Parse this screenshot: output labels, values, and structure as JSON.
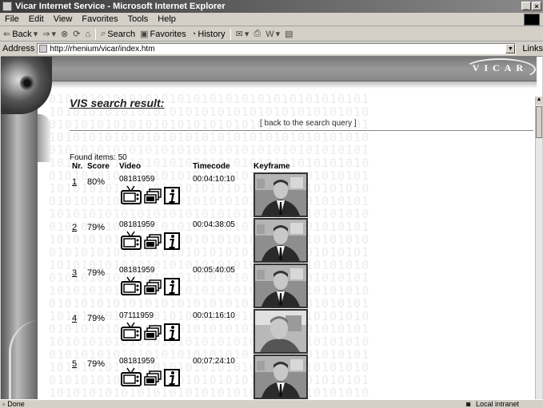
{
  "window": {
    "title": "Vicar Internet Service - Microsoft Internet Explorer",
    "controls": [
      "_",
      "×"
    ]
  },
  "menu": [
    "File",
    "Edit",
    "View",
    "Favorites",
    "Tools",
    "Help"
  ],
  "toolbar": {
    "back": "Back",
    "search": "Search",
    "favorites": "Favorites",
    "history": "History"
  },
  "address": {
    "label": "Address",
    "url": "http://rhenium/vicar/index.htm",
    "links": "Links"
  },
  "page": {
    "brand": "VICAR",
    "heading": "VIS search result:",
    "back_link": "[ back to the search query ]",
    "found": "Found items: 50",
    "columns": {
      "nr": "Nr.",
      "score": "Score",
      "video": "Video",
      "timecode": "Timecode",
      "keyframe": "Keyframe"
    },
    "results": [
      {
        "nr": "1",
        "score": "80%",
        "video": "08181959",
        "timecode": "00:04:10:10"
      },
      {
        "nr": "2",
        "score": "79%",
        "video": "08181959",
        "timecode": "00:04:38:05"
      },
      {
        "nr": "3",
        "score": "79%",
        "video": "08181959",
        "timecode": "00:05:40:05"
      },
      {
        "nr": "4",
        "score": "79%",
        "video": "07111959",
        "timecode": "00:01:16:10"
      },
      {
        "nr": "5",
        "score": "79%",
        "video": "08181959",
        "timecode": "00:07:24:10"
      }
    ]
  },
  "status": {
    "left": "Done",
    "right": "Local intranet"
  }
}
